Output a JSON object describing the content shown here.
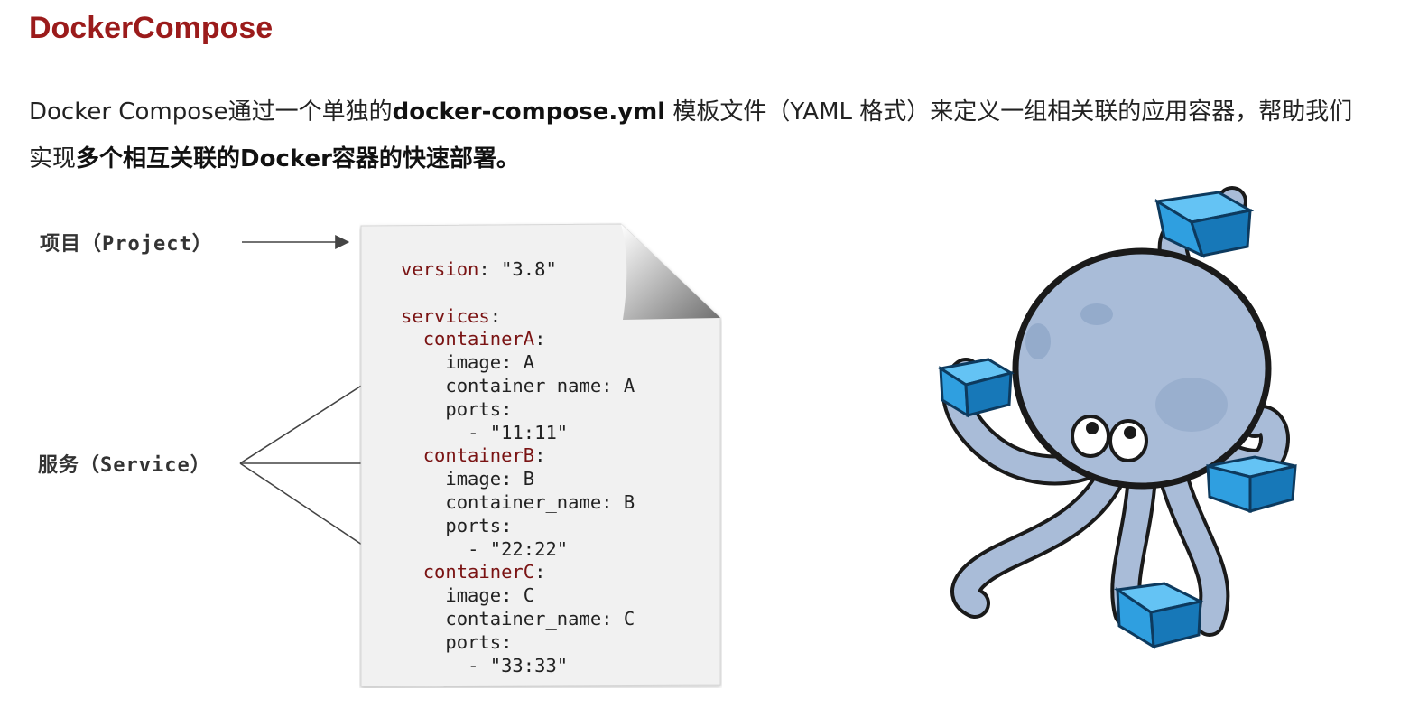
{
  "title": "DockerCompose",
  "intro": {
    "part1": "Docker Compose通过一个单独的",
    "file_name": "docker-compose.yml",
    "part2": " 模板文件（YAML 格式）来定义一组相关联的应用容器，帮助我们实现",
    "highlight": "多个相互关联的Docker容器的快速部署。"
  },
  "labels": {
    "project": "项目（Project）",
    "service": "服务（Service）"
  },
  "compose_file": {
    "version_key": "version",
    "version_value": "\"3.8\"",
    "services_key": "services",
    "containers": [
      {
        "name": "containerA",
        "image_key": "image",
        "image": "A",
        "cname_key": "container_name",
        "cname": "A",
        "ports_key": "ports",
        "port": "- \"11:11\""
      },
      {
        "name": "containerB",
        "image_key": "image",
        "image": "B",
        "cname_key": "container_name",
        "cname": "B",
        "ports_key": "ports",
        "port": "- \"22:22\""
      },
      {
        "name": "containerC",
        "image_key": "image",
        "image": "C",
        "cname_key": "container_name",
        "cname": "C",
        "ports_key": "ports",
        "port": "- \"33:33\""
      }
    ]
  },
  "illustration": {
    "subject": "docker-compose-octopus-logo",
    "colors": {
      "body": "#a9bcd8",
      "box": "#2f9fe0",
      "outline": "#1a1a1a"
    }
  },
  "colors": {
    "title": "#9b1b1b",
    "code_key": "#7a1313",
    "paper": "#f1f1f1"
  }
}
